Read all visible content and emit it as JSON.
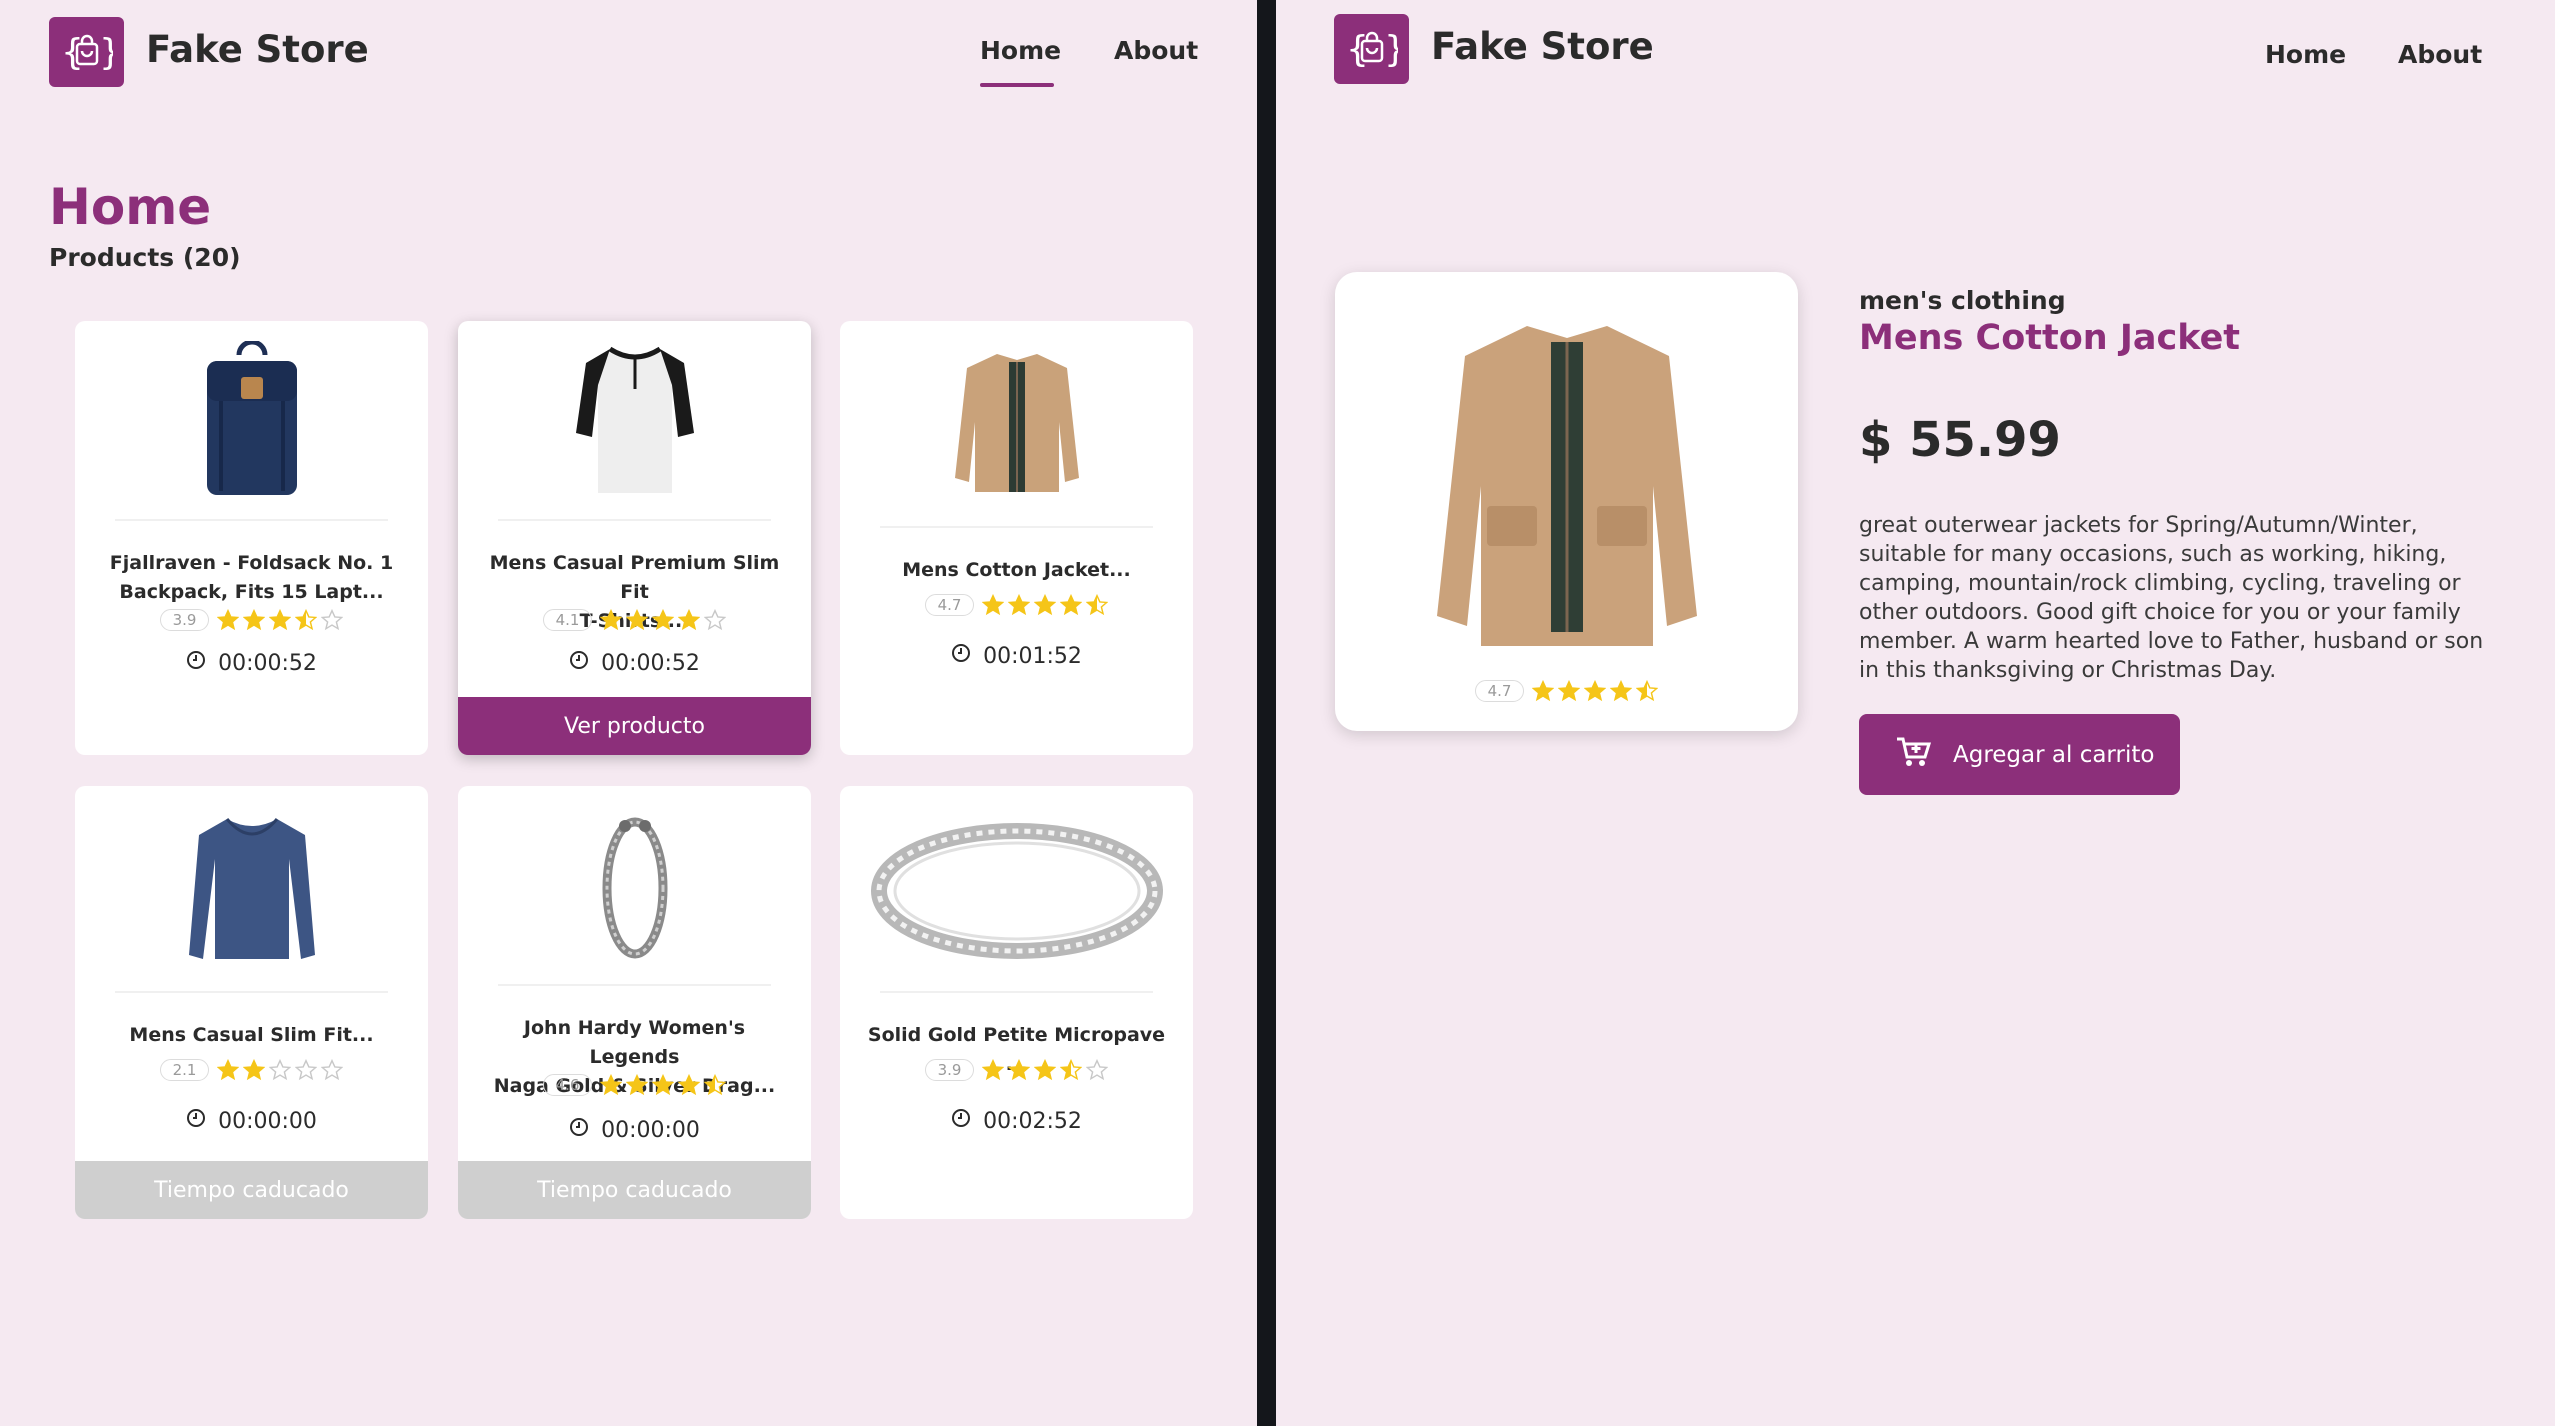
{
  "brand": {
    "name": "Fake Store",
    "logo_icon": "shopping-bag-icon",
    "color": "#8c2f7a"
  },
  "nav": {
    "home": "Home",
    "about": "About",
    "active": "Home"
  },
  "home": {
    "title": "Home",
    "subtitle": "Products (20)",
    "cards": [
      {
        "title_l1": "Fjallraven - Foldsack No. 1",
        "title_l2": "Backpack, Fits 15 Lapt...",
        "rating": "3.9",
        "stars": 3.5,
        "timer": "00:00:52",
        "button": "",
        "image": "backpack"
      },
      {
        "title_l1": "Mens Casual Premium Slim Fit",
        "title_l2": "T-Shirts ...",
        "rating": "4.1",
        "stars": 4,
        "timer": "00:00:52",
        "button": "Ver producto",
        "image": "tshirt"
      },
      {
        "title_l1": "Mens Cotton Jacket...",
        "title_l2": "",
        "rating": "4.7",
        "stars": 4.5,
        "timer": "00:01:52",
        "button": "",
        "image": "jacket"
      },
      {
        "title_l1": "Mens Casual Slim Fit...",
        "title_l2": "",
        "rating": "2.1",
        "stars": 2,
        "timer": "00:00:00",
        "button": "Tiempo caducado",
        "image": "longsleeve"
      },
      {
        "title_l1": "John Hardy Women's Legends",
        "title_l2": "Naga Gold & Silver Drag...",
        "rating": "4.6",
        "stars": 4.5,
        "timer": "00:00:00",
        "button": "Tiempo caducado",
        "image": "bracelet"
      },
      {
        "title_l1": "Solid Gold Petite Micropave ...",
        "title_l2": "",
        "rating": "3.9",
        "stars": 3.5,
        "timer": "00:02:52",
        "button": "",
        "image": "ring"
      }
    ]
  },
  "detail": {
    "category": "men's clothing",
    "title": "Mens Cotton Jacket",
    "price": "$ 55.99",
    "rating": "4.7",
    "stars": 4.5,
    "description": "great outerwear jackets for Spring/Autumn/Winter, suitable for many occasions, such as working, hiking, camping, mountain/rock climbing, cycling, traveling or other outdoors. Good gift choice for you or your family member. A warm hearted love to Father, husband or son in this thanksgiving or Christmas Day.",
    "cart_button": "Agregar al carrito",
    "cart_icon": "cart-plus-icon"
  },
  "colors": {
    "accent": "#8c2f7a",
    "star": "#f5c518",
    "background": "#f5e9f1",
    "expired": "#cfcfcf"
  }
}
